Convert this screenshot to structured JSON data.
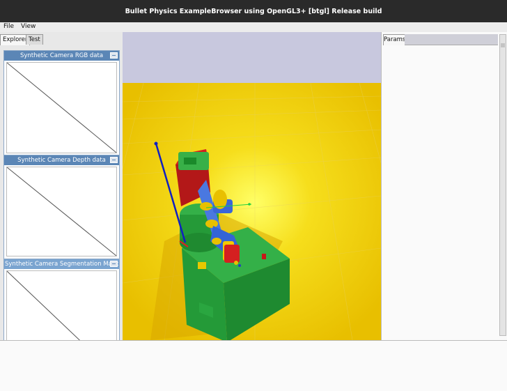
{
  "window": {
    "title": "Bullet Physics ExampleBrowser using OpenGL3+ [btgl] Release build"
  },
  "menu": {
    "file": "File",
    "view": "View"
  },
  "tabs": {
    "explorer": "Explorer",
    "test": "Test"
  },
  "camera_windows": [
    {
      "title": "Synthetic Camera RGB data"
    },
    {
      "title": "Synthetic Camera Depth data"
    },
    {
      "title": "Synthetic Camera Segmentation Mask"
    }
  ],
  "params": {
    "tab": "Params"
  },
  "colors": {
    "titlebar": "#2a2a2a",
    "sky": "#c8c8de",
    "ground": "#ecc400",
    "window_title": "#5b86b6"
  }
}
